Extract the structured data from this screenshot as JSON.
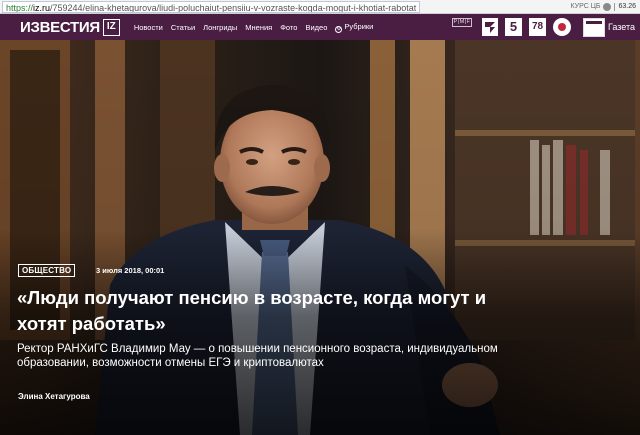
{
  "browser": {
    "url_scheme": "https://",
    "url_host": "iz.ru",
    "url_path": "/759244/elina-khetagurova/liudi-poluchaiut-pensiiu-v-vozraste-kogda-mogut-i-khotiat-rabotat"
  },
  "currency": {
    "label": "КУРС ЦБ",
    "value": "63.26"
  },
  "header": {
    "logo_text": "ИЗВЕСТИЯ",
    "logo_badge": "IZ",
    "nav": [
      {
        "label": "Новости"
      },
      {
        "label": "Статьи"
      },
      {
        "label": "Лонгриды"
      },
      {
        "label": "Мнения"
      },
      {
        "label": "Фото"
      },
      {
        "label": "Видео"
      },
      {
        "label": "Рубрики"
      }
    ],
    "partners_label": "Р|M|F",
    "channels": {
      "five": "5",
      "seventy_eight": "78"
    },
    "gazeta_label": "Газета"
  },
  "article": {
    "rubric": "ОБЩЕСТВО",
    "date": "3 июля 2018, 00:01",
    "title_line1": "«Люди получают пенсию в возрасте, когда могут и",
    "title_line2": "хотят работать»",
    "lead_line1": "Ректор РАНХиГС Владимир Мау — о повышении пенсионного возраста, индивидуальном",
    "lead_line2": "образовании, возможности отмены ЕГЭ и криптовалютах",
    "author": "Элина Хетагурова"
  },
  "colors": {
    "header_bg": "#4a1d42",
    "channel_red": "#c6263b"
  }
}
